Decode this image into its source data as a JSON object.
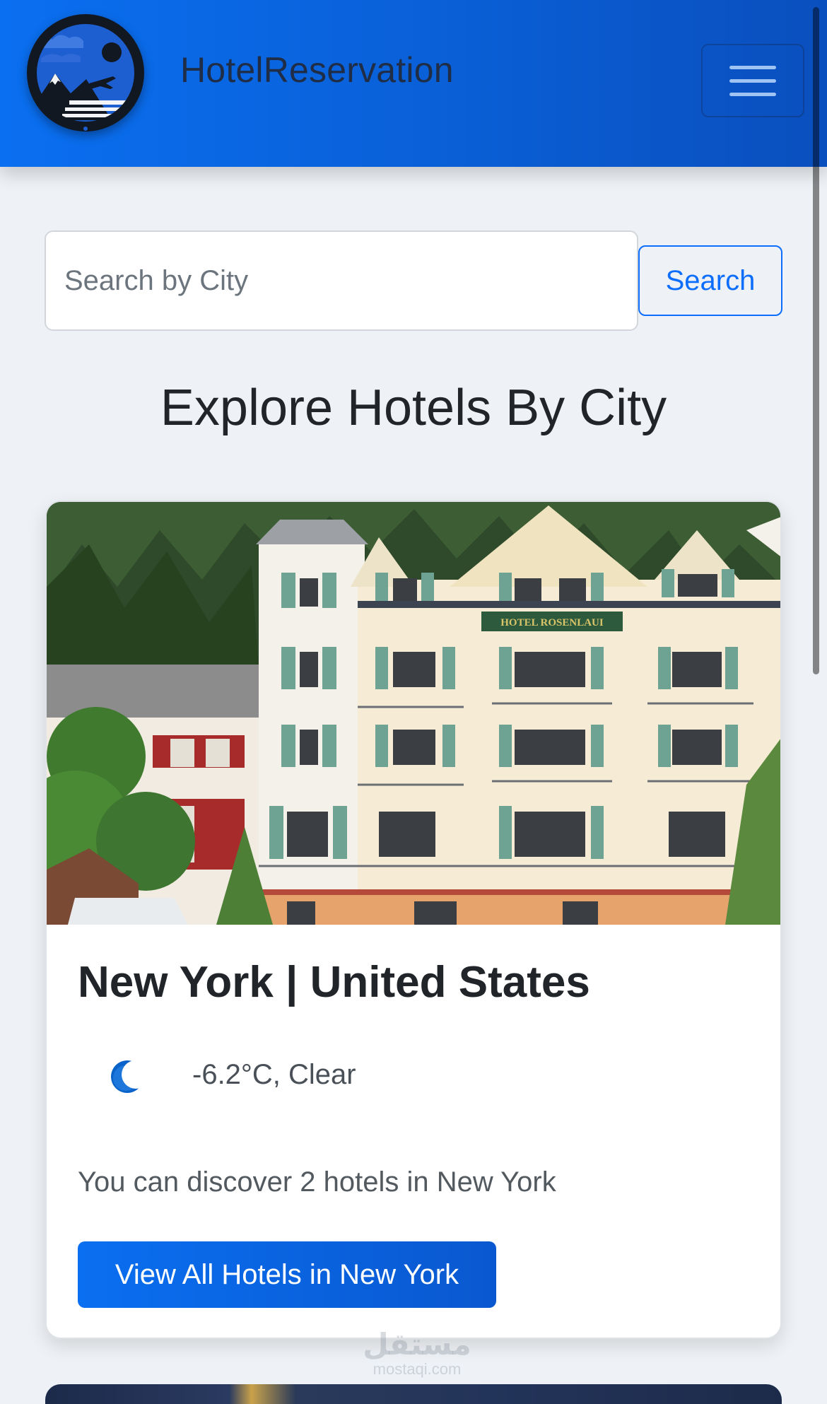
{
  "navbar": {
    "brand": "HotelReservation",
    "logo_icon": "travel-landscape-logo-icon",
    "menu_icon": "hamburger-menu-icon"
  },
  "search": {
    "placeholder": "Search by City",
    "value": "",
    "button_label": "Search"
  },
  "section_title": "Explore Hotels By City",
  "cards": [
    {
      "image_sign": "HOTEL ROSENLAUI",
      "title": "New York | United States",
      "weather_icon": "crescent-moon-icon",
      "weather": "-6.2°C, Clear",
      "description": "You can discover 2 hotels in New York",
      "button_label": "View All Hotels in New York"
    }
  ],
  "watermark": {
    "arabic": "مستقل",
    "text": "mostaqi.com"
  },
  "colors": {
    "primary": "#0d6efd",
    "navbar_start": "#0a6ff0",
    "navbar_end": "#0a4fbe",
    "page_bg": "#eef1f5"
  }
}
